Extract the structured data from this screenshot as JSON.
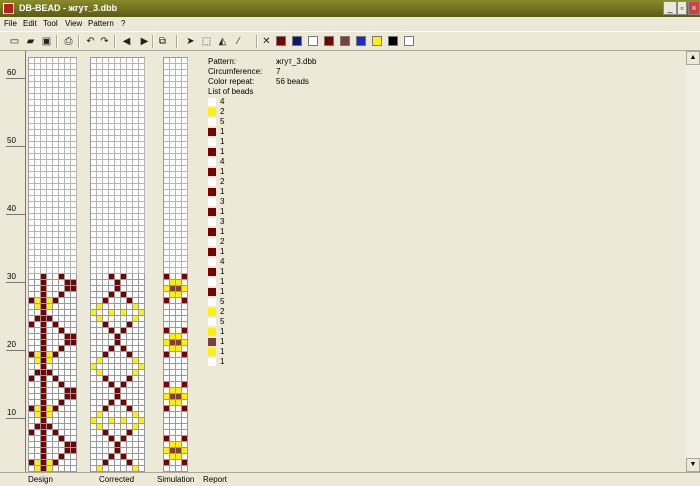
{
  "window": {
    "title": "DB-BEAD - жгут_3.dbb",
    "min": "_",
    "max": "▫",
    "close": "×"
  },
  "menu": [
    "File",
    "Edit",
    "Tool",
    "View",
    "Pattern",
    "?"
  ],
  "toolbar": {
    "icons": [
      "new-icon",
      "open-icon",
      "save-icon",
      "print-icon",
      "undo-icon",
      "redo-icon",
      "prev-icon",
      "next-icon",
      "copy-icon",
      "pointer-icon",
      "select-icon",
      "fill-icon",
      "picker-icon"
    ],
    "glyphs": [
      "▭",
      "▰",
      "▣",
      "⎙",
      "↶",
      "↷",
      "◀",
      "▶",
      "⧉",
      "➤",
      "⬚",
      "◭",
      "⁄"
    ],
    "clear_glyph": "✕",
    "palette": [
      "#7A0000",
      "#0A1A7A",
      "#FFFFFF",
      "#7A0000",
      "#7E3F3F",
      "#1A2AD0",
      "#FFF200",
      "#000000",
      "#FFFFFF"
    ]
  },
  "ruler": {
    "labels": [
      "60",
      "50",
      "40",
      "30",
      "20",
      "10"
    ]
  },
  "info": {
    "pattern_label": "Pattern:",
    "pattern_value": "жгут_3.dbb",
    "circ_label": "Circumference:",
    "circ_value": "7",
    "repeat_label": "Color repeat:",
    "repeat_value": "56 beads",
    "list_label": "List of beads"
  },
  "bead_list": [
    {
      "color": "#FFFFFF",
      "count": "4"
    },
    {
      "color": "#FFF200",
      "count": "2"
    },
    {
      "color": "#FFFFFF",
      "count": "5"
    },
    {
      "color": "#7A0000",
      "count": "1"
    },
    {
      "color": "#FFFFFF",
      "count": "1"
    },
    {
      "color": "#7A0000",
      "count": "1"
    },
    {
      "color": "#FFFFFF",
      "count": "4"
    },
    {
      "color": "#7A0000",
      "count": "1"
    },
    {
      "color": "#FFFFFF",
      "count": "2"
    },
    {
      "color": "#7A0000",
      "count": "1"
    },
    {
      "color": "#FFFFFF",
      "count": "3"
    },
    {
      "color": "#7A0000",
      "count": "1"
    },
    {
      "color": "#FFFFFF",
      "count": "3"
    },
    {
      "color": "#7A0000",
      "count": "1"
    },
    {
      "color": "#FFFFFF",
      "count": "2"
    },
    {
      "color": "#7A0000",
      "count": "1"
    },
    {
      "color": "#FFFFFF",
      "count": "4"
    },
    {
      "color": "#7A0000",
      "count": "1"
    },
    {
      "color": "#FFFFFF",
      "count": "1"
    },
    {
      "color": "#7A0000",
      "count": "1"
    },
    {
      "color": "#FFFFFF",
      "count": "5"
    },
    {
      "color": "#FFF200",
      "count": "2"
    },
    {
      "color": "#FFFFFF",
      "count": "5"
    },
    {
      "color": "#FFF200",
      "count": "1"
    },
    {
      "color": "#7E3F3F",
      "count": "1"
    },
    {
      "color": "#FFF200",
      "count": "1"
    },
    {
      "color": "#FFFFFF",
      "count": "1"
    }
  ],
  "tabs": [
    "Design",
    "Corrected",
    "Simulation",
    "Report"
  ],
  "colors": {
    "dark": "#7A0000",
    "yellow": "#FFF200",
    "brown": "#7E3F3F",
    "white": "#FFFFFF"
  }
}
